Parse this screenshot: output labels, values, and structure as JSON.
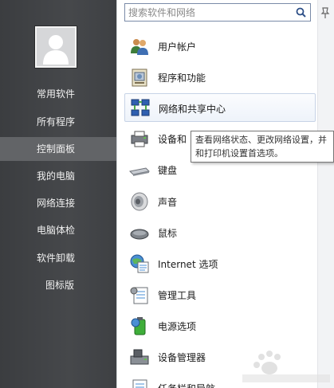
{
  "sidebar": {
    "items": [
      {
        "label": "常用软件"
      },
      {
        "label": "所有程序"
      },
      {
        "label": "控制面板"
      },
      {
        "label": "我的电脑"
      },
      {
        "label": "网络连接"
      },
      {
        "label": "电脑体检"
      },
      {
        "label": "软件卸载"
      },
      {
        "label": "图标版"
      }
    ],
    "active_index": 2
  },
  "search": {
    "placeholder": "搜索软件和网络"
  },
  "control_panel": {
    "items": [
      {
        "label": "用户帐户",
        "icon": "users-icon"
      },
      {
        "label": "程序和功能",
        "icon": "programs-icon"
      },
      {
        "label": "网络和共享中心",
        "icon": "network-icon"
      },
      {
        "label": "设备和",
        "icon": "printer-icon"
      },
      {
        "label": "键盘",
        "icon": "keyboard-icon"
      },
      {
        "label": "声音",
        "icon": "speaker-icon"
      },
      {
        "label": "鼠标",
        "icon": "mouse-icon"
      },
      {
        "label": "Internet 选项",
        "icon": "internet-options-icon"
      },
      {
        "label": "管理工具",
        "icon": "admin-tools-icon"
      },
      {
        "label": "电源选项",
        "icon": "power-options-icon"
      },
      {
        "label": "设备管理器",
        "icon": "device-manager-icon"
      },
      {
        "label": "任务栏和导航",
        "icon": "taskbar-icon"
      }
    ],
    "hovered_index": 2
  },
  "tooltip": {
    "line1": "查看网络状态、更改网络设置，并",
    "line2": "和打印机设置首选项。"
  },
  "colors": {
    "sidebar_bg": "#404245",
    "sidebar_active": "#626467",
    "sidebar_text": "#f1f1f1",
    "search_border": "#7a8ba8"
  }
}
